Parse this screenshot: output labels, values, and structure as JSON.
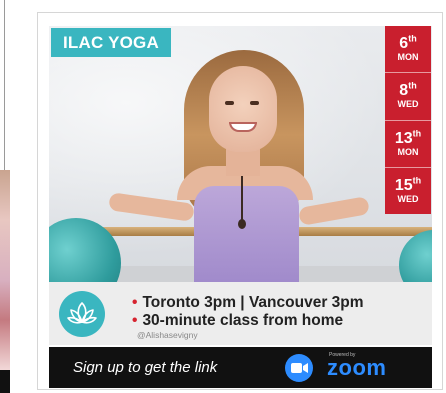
{
  "poster": {
    "brand": "ILAC YOGA",
    "dates": [
      {
        "day": "6",
        "suffix": "th",
        "weekday": "MON"
      },
      {
        "day": "8",
        "suffix": "th",
        "weekday": "WED"
      },
      {
        "day": "13",
        "suffix": "th",
        "weekday": "MON"
      },
      {
        "day": "15",
        "suffix": "th",
        "weekday": "WED"
      }
    ],
    "info": {
      "line1": "Toronto 3pm | Vancouver 3pm",
      "line2": "30-minute class from home",
      "handle": "@Alishasevigny"
    },
    "cta": {
      "text": "Sign up to get the link",
      "powered": "Powered by",
      "zoom": "zoom"
    }
  },
  "colors": {
    "teal": "#3ab6c0",
    "red": "#c91f2e",
    "zoom_blue": "#2d8cff",
    "cta_bg": "#111111"
  },
  "icons": [
    "lotus-icon",
    "zoom-camera-icon"
  ]
}
